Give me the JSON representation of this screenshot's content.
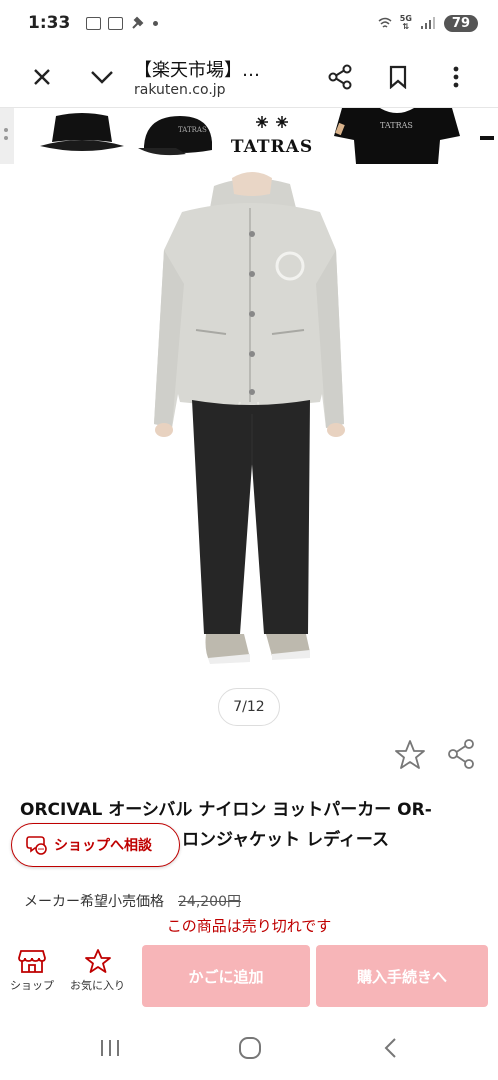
{
  "status_bar": {
    "time": "1:33",
    "network": "5G",
    "battery": "79"
  },
  "toolbar": {
    "title": "【楽天市場】…",
    "url": "rakuten.co.jp"
  },
  "banner": {
    "brand": "TATRAS"
  },
  "gallery": {
    "counter": "7/12"
  },
  "product": {
    "title_line1": "ORCIVAL オーシバル ナイロン ヨットパーカー OR-",
    "title_line2": "ロンジャケット レディース",
    "price_label": "メーカー希望小売価格",
    "price_value": "24,200円",
    "soldout": "この商品は売り切れです"
  },
  "consult": {
    "label": "ショップへ相談"
  },
  "action_bar": {
    "shop_label": "ショップ",
    "favorite_label": "お気に入り",
    "cart_label": "かごに追加",
    "buy_label": "購入手続きへ"
  },
  "colors": {
    "accent": "#bf0000",
    "button_disabled": "#f7b5b8"
  },
  "icons": [
    "close-icon",
    "chevron-down-icon",
    "share-icon",
    "bookmark-icon",
    "more-vert-icon",
    "star-icon",
    "chat-icon",
    "shop-icon",
    "back-icon",
    "home-icon",
    "recents-icon"
  ]
}
